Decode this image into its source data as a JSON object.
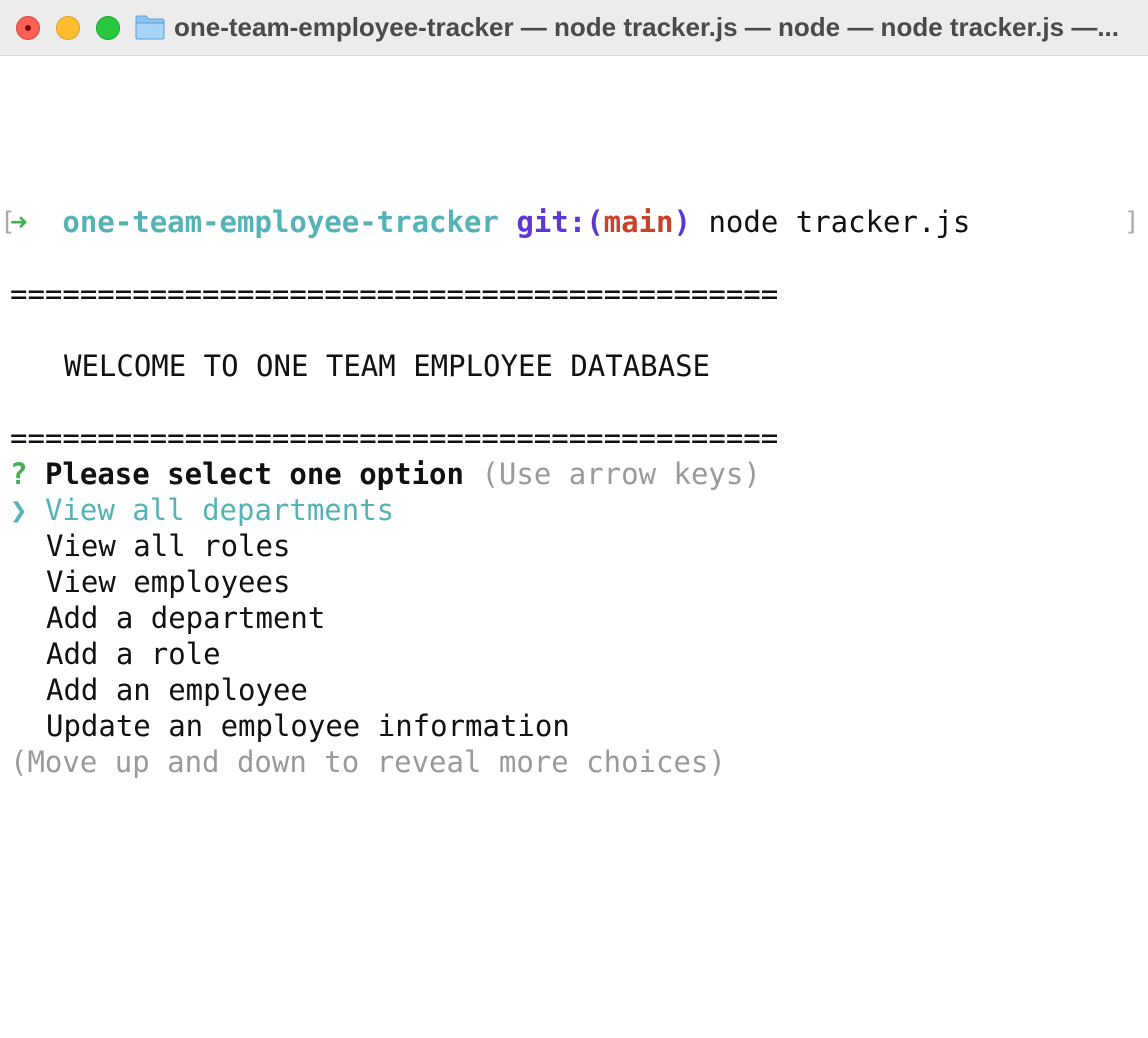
{
  "window": {
    "title": "one-team-employee-tracker — node tracker.js — node — node tracker.js —..."
  },
  "shell": {
    "arrow": "➜",
    "cwd": "one-team-employee-tracker",
    "git_prefix": "git:(",
    "branch": "main",
    "git_suffix": ")",
    "command": "node tracker.js"
  },
  "banner": {
    "rule": "============================================",
    "welcome": "WELCOME TO ONE TEAM EMPLOYEE DATABASE"
  },
  "inquirer": {
    "question_mark": "?",
    "question": "Please select one option",
    "hint": "(Use arrow keys)",
    "pointer": "❯",
    "choices": [
      "View all departments",
      "View all roles",
      "View employees",
      "Add a department",
      "Add a role",
      "Add an employee",
      "Update an employee information"
    ],
    "selected_index": 0,
    "more_hint": "(Move up and down to reveal more choices)"
  },
  "colors": {
    "cwd": "#55b3b8",
    "git": "#5d36d6",
    "branch": "#c8412c",
    "arrow": "#3fb24e",
    "hint": "#9a9a9a"
  }
}
